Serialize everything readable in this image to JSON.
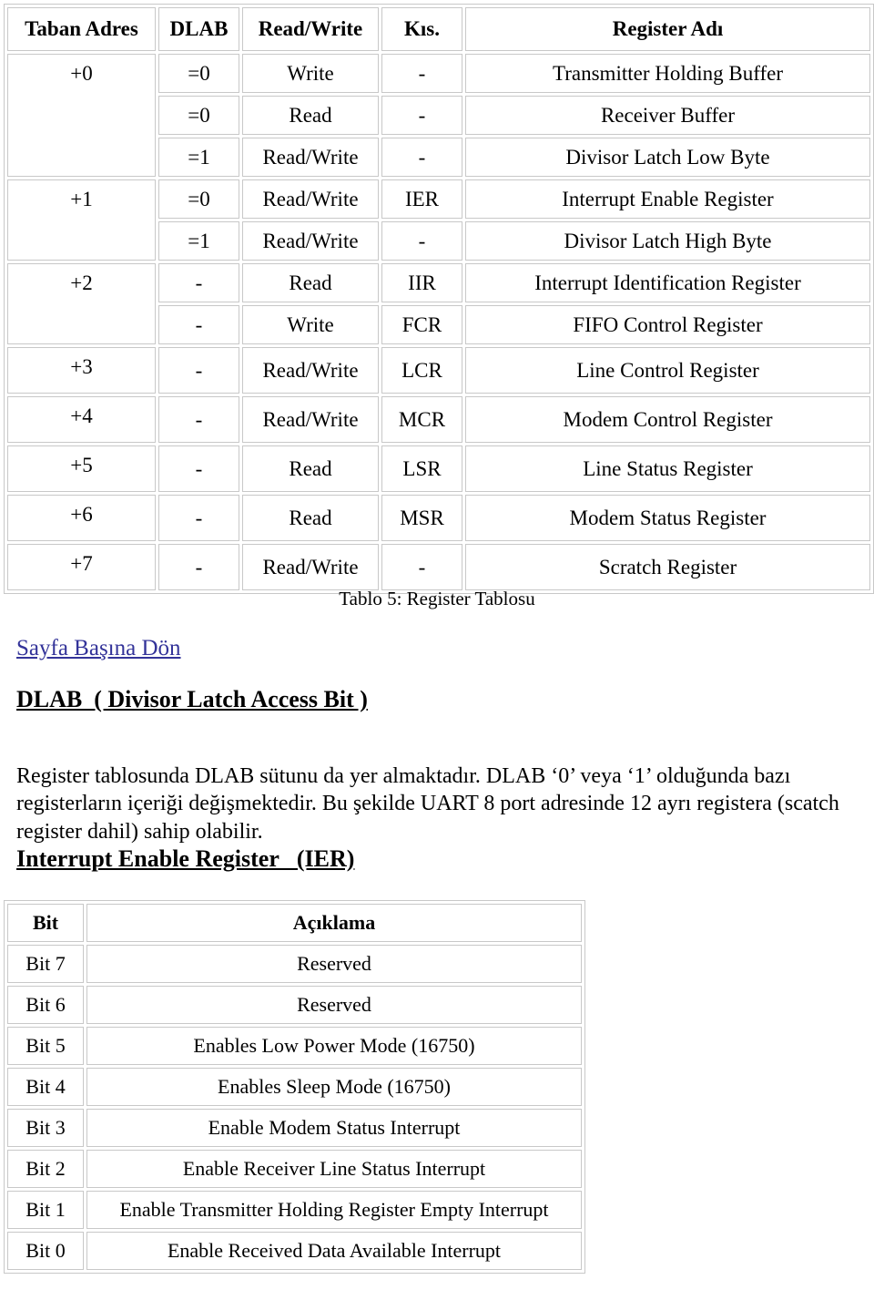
{
  "register_table": {
    "headers": [
      "Taban Adres",
      "DLAB",
      "Read/Write",
      "Kıs.",
      "Register Adı"
    ],
    "rows": [
      {
        "addr": "+0",
        "addr_rowspan": 3,
        "dlab": "=0",
        "rw": "Write",
        "abbr": "-",
        "name": "Transmitter Holding Buffer"
      },
      {
        "addr": null,
        "addr_rowspan": 0,
        "dlab": "=0",
        "rw": "Read",
        "abbr": "-",
        "name": "Receiver Buffer"
      },
      {
        "addr": null,
        "addr_rowspan": 0,
        "dlab": "=1",
        "rw": "Read/Write",
        "abbr": "-",
        "name": "Divisor Latch Low Byte"
      },
      {
        "addr": "+1",
        "addr_rowspan": 2,
        "dlab": "=0",
        "rw": "Read/Write",
        "abbr": "IER",
        "name": "Interrupt Enable Register"
      },
      {
        "addr": null,
        "addr_rowspan": 0,
        "dlab": "=1",
        "rw": "Read/Write",
        "abbr": "-",
        "name": "Divisor Latch High Byte"
      },
      {
        "addr": "+2",
        "addr_rowspan": 2,
        "dlab": "-",
        "rw": "Read",
        "abbr": "IIR",
        "name": "Interrupt Identification Register"
      },
      {
        "addr": null,
        "addr_rowspan": 0,
        "dlab": "-",
        "rw": "Write",
        "abbr": "FCR",
        "name": "FIFO Control Register"
      },
      {
        "addr": "+3",
        "addr_rowspan": 1,
        "dlab": "-",
        "rw": "Read/Write",
        "abbr": "LCR",
        "name": "Line Control Register"
      },
      {
        "addr": "+4",
        "addr_rowspan": 1,
        "dlab": "-",
        "rw": "Read/Write",
        "abbr": "MCR",
        "name": "Modem Control Register"
      },
      {
        "addr": "+5",
        "addr_rowspan": 1,
        "dlab": "-",
        "rw": "Read",
        "abbr": "LSR",
        "name": "Line Status Register"
      },
      {
        "addr": "+6",
        "addr_rowspan": 1,
        "dlab": "-",
        "rw": "Read",
        "abbr": "MSR",
        "name": "Modem Status Register"
      },
      {
        "addr": "+7",
        "addr_rowspan": 1,
        "dlab": "-",
        "rw": "Read/Write",
        "abbr": "-",
        "name": "Scratch Register"
      }
    ]
  },
  "caption": "Tablo 5: Register Tablosu",
  "back_link": {
    "label": "Sayfa Başına Dön",
    "color": "#333399"
  },
  "dlab_section": {
    "heading": "DLAB  ( Divisor Latch Access Bit )",
    "paragraph": "Register tablosunda DLAB sütunu da yer almaktadır. DLAB ‘0’ veya ‘1’ olduğunda bazı registerların içeriği değişmektedir. Bu şekilde UART 8 port adresinde 12 ayrı registera (scatch register dahil) sahip olabilir."
  },
  "ier_section": {
    "heading": "Interrupt Enable Register   (IER)",
    "table": {
      "headers": [
        "Bit",
        "Açıklama"
      ],
      "rows": [
        {
          "bit": "Bit 7",
          "desc": "Reserved"
        },
        {
          "bit": "Bit 6",
          "desc": "Reserved"
        },
        {
          "bit": "Bit 5",
          "desc": "Enables Low Power Mode (16750)"
        },
        {
          "bit": "Bit 4",
          "desc": "Enables Sleep Mode (16750)"
        },
        {
          "bit": "Bit 3",
          "desc": "Enable Modem Status Interrupt"
        },
        {
          "bit": "Bit 2",
          "desc": "Enable Receiver Line Status Interrupt"
        },
        {
          "bit": "Bit 1",
          "desc": "Enable Transmitter Holding Register Empty Interrupt"
        },
        {
          "bit": "Bit 0",
          "desc": "Enable Received Data Available Interrupt"
        }
      ]
    }
  }
}
